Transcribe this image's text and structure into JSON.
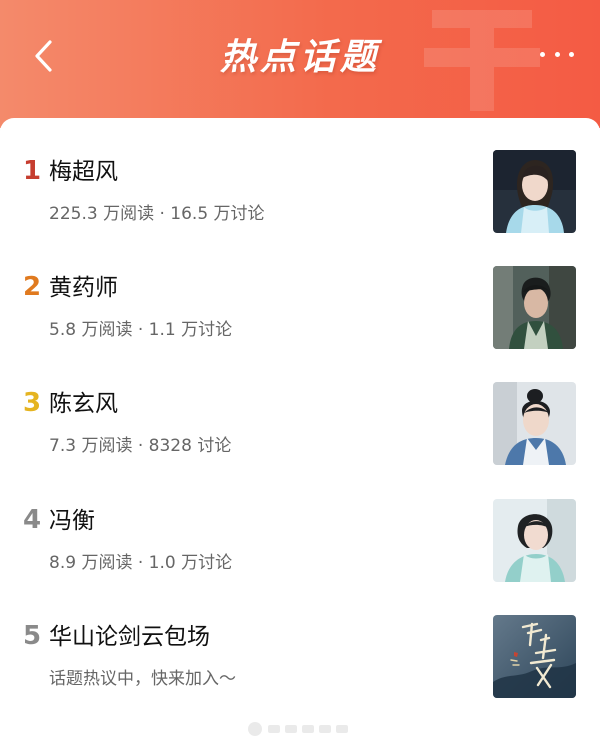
{
  "header": {
    "title": "热点话题",
    "back_icon": "chevron-left-icon",
    "more_icon": "more-horizontal-icon",
    "colors": {
      "gradient_start": "#f48a6b",
      "gradient_end": "#f45b44"
    }
  },
  "topics": [
    {
      "rank": "1",
      "rank_color": "#c63d2f",
      "title": "梅超风",
      "meta": "225.3 万阅读 · 16.5 万讨论"
    },
    {
      "rank": "2",
      "rank_color": "#e07a1f",
      "title": "黄药师",
      "meta": "5.8 万阅读 · 1.1 万讨论"
    },
    {
      "rank": "3",
      "rank_color": "#e5b421",
      "title": "陈玄风",
      "meta": "7.3 万阅读 · 8328 讨论"
    },
    {
      "rank": "4",
      "rank_color": "#8a8a8a",
      "title": "冯衡",
      "meta": "8.9 万阅读 · 1.0 万讨论"
    },
    {
      "rank": "5",
      "rank_color": "#8a8a8a",
      "title": "华山论剑云包场",
      "meta": "话题热议中，快来加入～"
    }
  ]
}
